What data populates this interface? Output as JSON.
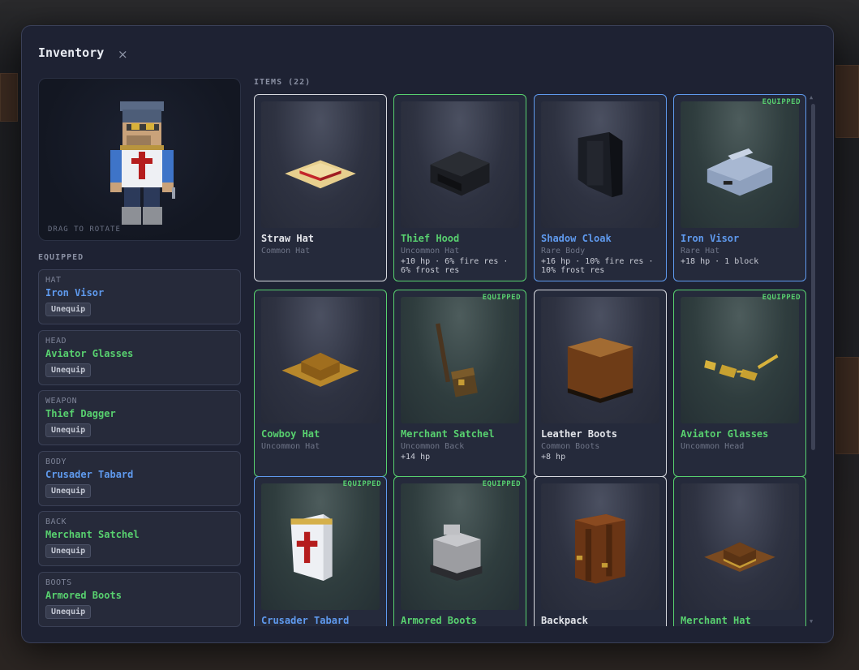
{
  "window": {
    "title": "Inventory",
    "close_glyph": "×"
  },
  "preview": {
    "hint": "DRAG TO ROTATE"
  },
  "equipped_section": {
    "label": "EQUIPPED",
    "slots": [
      {
        "type": "HAT",
        "item": "Iron Visor",
        "rarity": "rare",
        "button": "Unequip"
      },
      {
        "type": "HEAD",
        "item": "Aviator Glasses",
        "rarity": "uncommon",
        "button": "Unequip"
      },
      {
        "type": "WEAPON",
        "item": "Thief Dagger",
        "rarity": "uncommon",
        "button": "Unequip"
      },
      {
        "type": "BODY",
        "item": "Crusader Tabard",
        "rarity": "rare",
        "button": "Unequip"
      },
      {
        "type": "BACK",
        "item": "Merchant Satchel",
        "rarity": "uncommon",
        "button": "Unequip"
      },
      {
        "type": "BOOTS",
        "item": "Armored Boots",
        "rarity": "uncommon",
        "button": "Unequip"
      }
    ]
  },
  "items_section": {
    "label": "ITEMS (22)",
    "equipped_tag": "EQUIPPED",
    "items": [
      {
        "name": "Straw Hat",
        "sub": "Common Hat",
        "stats": "",
        "rarity": "common",
        "equipped": false,
        "icon": "straw-hat-icon"
      },
      {
        "name": "Thief Hood",
        "sub": "Uncommon Hat",
        "stats": "+10 hp · 6% fire res · 6% frost res",
        "rarity": "uncommon",
        "equipped": false,
        "icon": "thief-hood-icon"
      },
      {
        "name": "Shadow Cloak",
        "sub": "Rare Body",
        "stats": "+16 hp · 10% fire res · 10% frost res",
        "rarity": "rare",
        "equipped": false,
        "icon": "shadow-cloak-icon"
      },
      {
        "name": "Iron Visor",
        "sub": "Rare Hat",
        "stats": "+18 hp · 1 block",
        "rarity": "rare",
        "equipped": true,
        "icon": "iron-visor-icon"
      },
      {
        "name": "Cowboy Hat",
        "sub": "Uncommon Hat",
        "stats": "",
        "rarity": "uncommon",
        "equipped": false,
        "icon": "cowboy-hat-icon"
      },
      {
        "name": "Merchant Satchel",
        "sub": "Uncommon Back",
        "stats": "+14 hp",
        "rarity": "uncommon",
        "equipped": true,
        "icon": "satchel-icon"
      },
      {
        "name": "Leather Boots",
        "sub": "Common Boots",
        "stats": "+8 hp",
        "rarity": "common",
        "equipped": false,
        "icon": "leather-boots-icon"
      },
      {
        "name": "Aviator Glasses",
        "sub": "Uncommon Head",
        "stats": "",
        "rarity": "uncommon",
        "equipped": true,
        "icon": "glasses-icon"
      },
      {
        "name": "Crusader Tabard",
        "sub": "",
        "stats": "",
        "rarity": "rare",
        "equipped": true,
        "icon": "tabard-icon"
      },
      {
        "name": "Armored Boots",
        "sub": "",
        "stats": "",
        "rarity": "uncommon",
        "equipped": true,
        "icon": "armored-boots-icon"
      },
      {
        "name": "Backpack",
        "sub": "",
        "stats": "",
        "rarity": "common",
        "equipped": false,
        "icon": "backpack-icon"
      },
      {
        "name": "Merchant Hat",
        "sub": "",
        "stats": "",
        "rarity": "uncommon",
        "equipped": false,
        "icon": "merchant-hat-icon"
      }
    ]
  },
  "colors": {
    "common": "#e3e5ea",
    "uncommon": "#58d06f",
    "rare": "#5f9aee",
    "panel": "#1e2233"
  }
}
